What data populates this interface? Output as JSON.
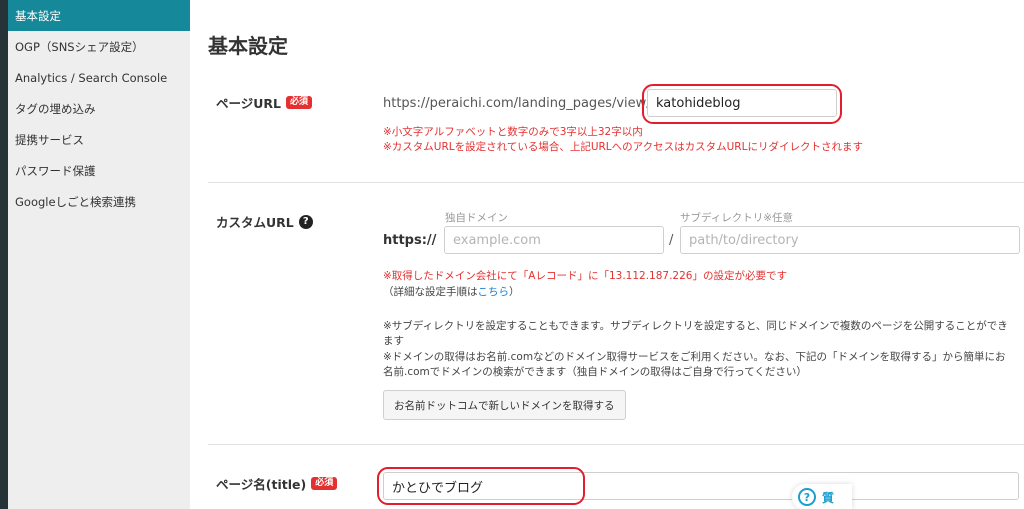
{
  "sidebar": {
    "items": [
      {
        "label": "基本設定",
        "active": true
      },
      {
        "label": "OGP（SNSシェア設定）",
        "active": false
      },
      {
        "label": "Analytics / Search Console",
        "active": false
      },
      {
        "label": "タグの埋め込み",
        "active": false
      },
      {
        "label": "提携サービス",
        "active": false
      },
      {
        "label": "パスワード保護",
        "active": false
      },
      {
        "label": "Googleしごと検索連携",
        "active": false
      }
    ]
  },
  "main": {
    "title": "基本設定",
    "page_url": {
      "label": "ページURL",
      "required_badge": "必須",
      "prefix": "https://peraichi.com/landing_pages/view/",
      "value": "katohideblog",
      "note1": "※小文字アルファベットと数字のみで3字以上32字以内",
      "note2": "※カスタムURLを設定されている場合、上記URLへのアクセスはカスタムURLにリダイレクトされます"
    },
    "custom_url": {
      "label": "カスタムURL",
      "help_icon": "?",
      "scheme": "https://",
      "domain_caption": "独自ドメイン",
      "domain_placeholder": "example.com",
      "separator": "/",
      "subdir_caption": "サブディレクトリ※任意",
      "subdir_placeholder": "path/to/directory",
      "dns_note": "※取得したドメイン会社にて「Aレコード」に「13.112.187.226」の設定が必要です",
      "detail_prefix": "（詳細な設定手順は",
      "detail_link": "こちら",
      "detail_suffix": "）",
      "sub_note_line1": "※サブディレクトリを設定することもできます。サブディレクトリを設定すると、同じドメインで複数のページを公開することができ",
      "sub_note_line2": "ます",
      "domain_note_line1": "※ドメインの取得はお名前.comなどのドメイン取得サービスをご利用ください。なお、下記の「ドメインを取得する」から簡単にお",
      "domain_note_line2": "名前.comでドメインの検索ができます（独自ドメインの取得はご自身で行ってください）",
      "button_label": "お名前ドットコムで新しいドメインを取得する"
    },
    "page_name": {
      "label": "ページ名(title)",
      "required_badge": "必須",
      "value": "かとひでブログ"
    }
  },
  "help_widget": {
    "icon": "?",
    "label": "質"
  },
  "colors": {
    "accent": "#15889a",
    "required": "#e53030",
    "highlight": "#e31e2c",
    "link": "#1a7fd0"
  }
}
